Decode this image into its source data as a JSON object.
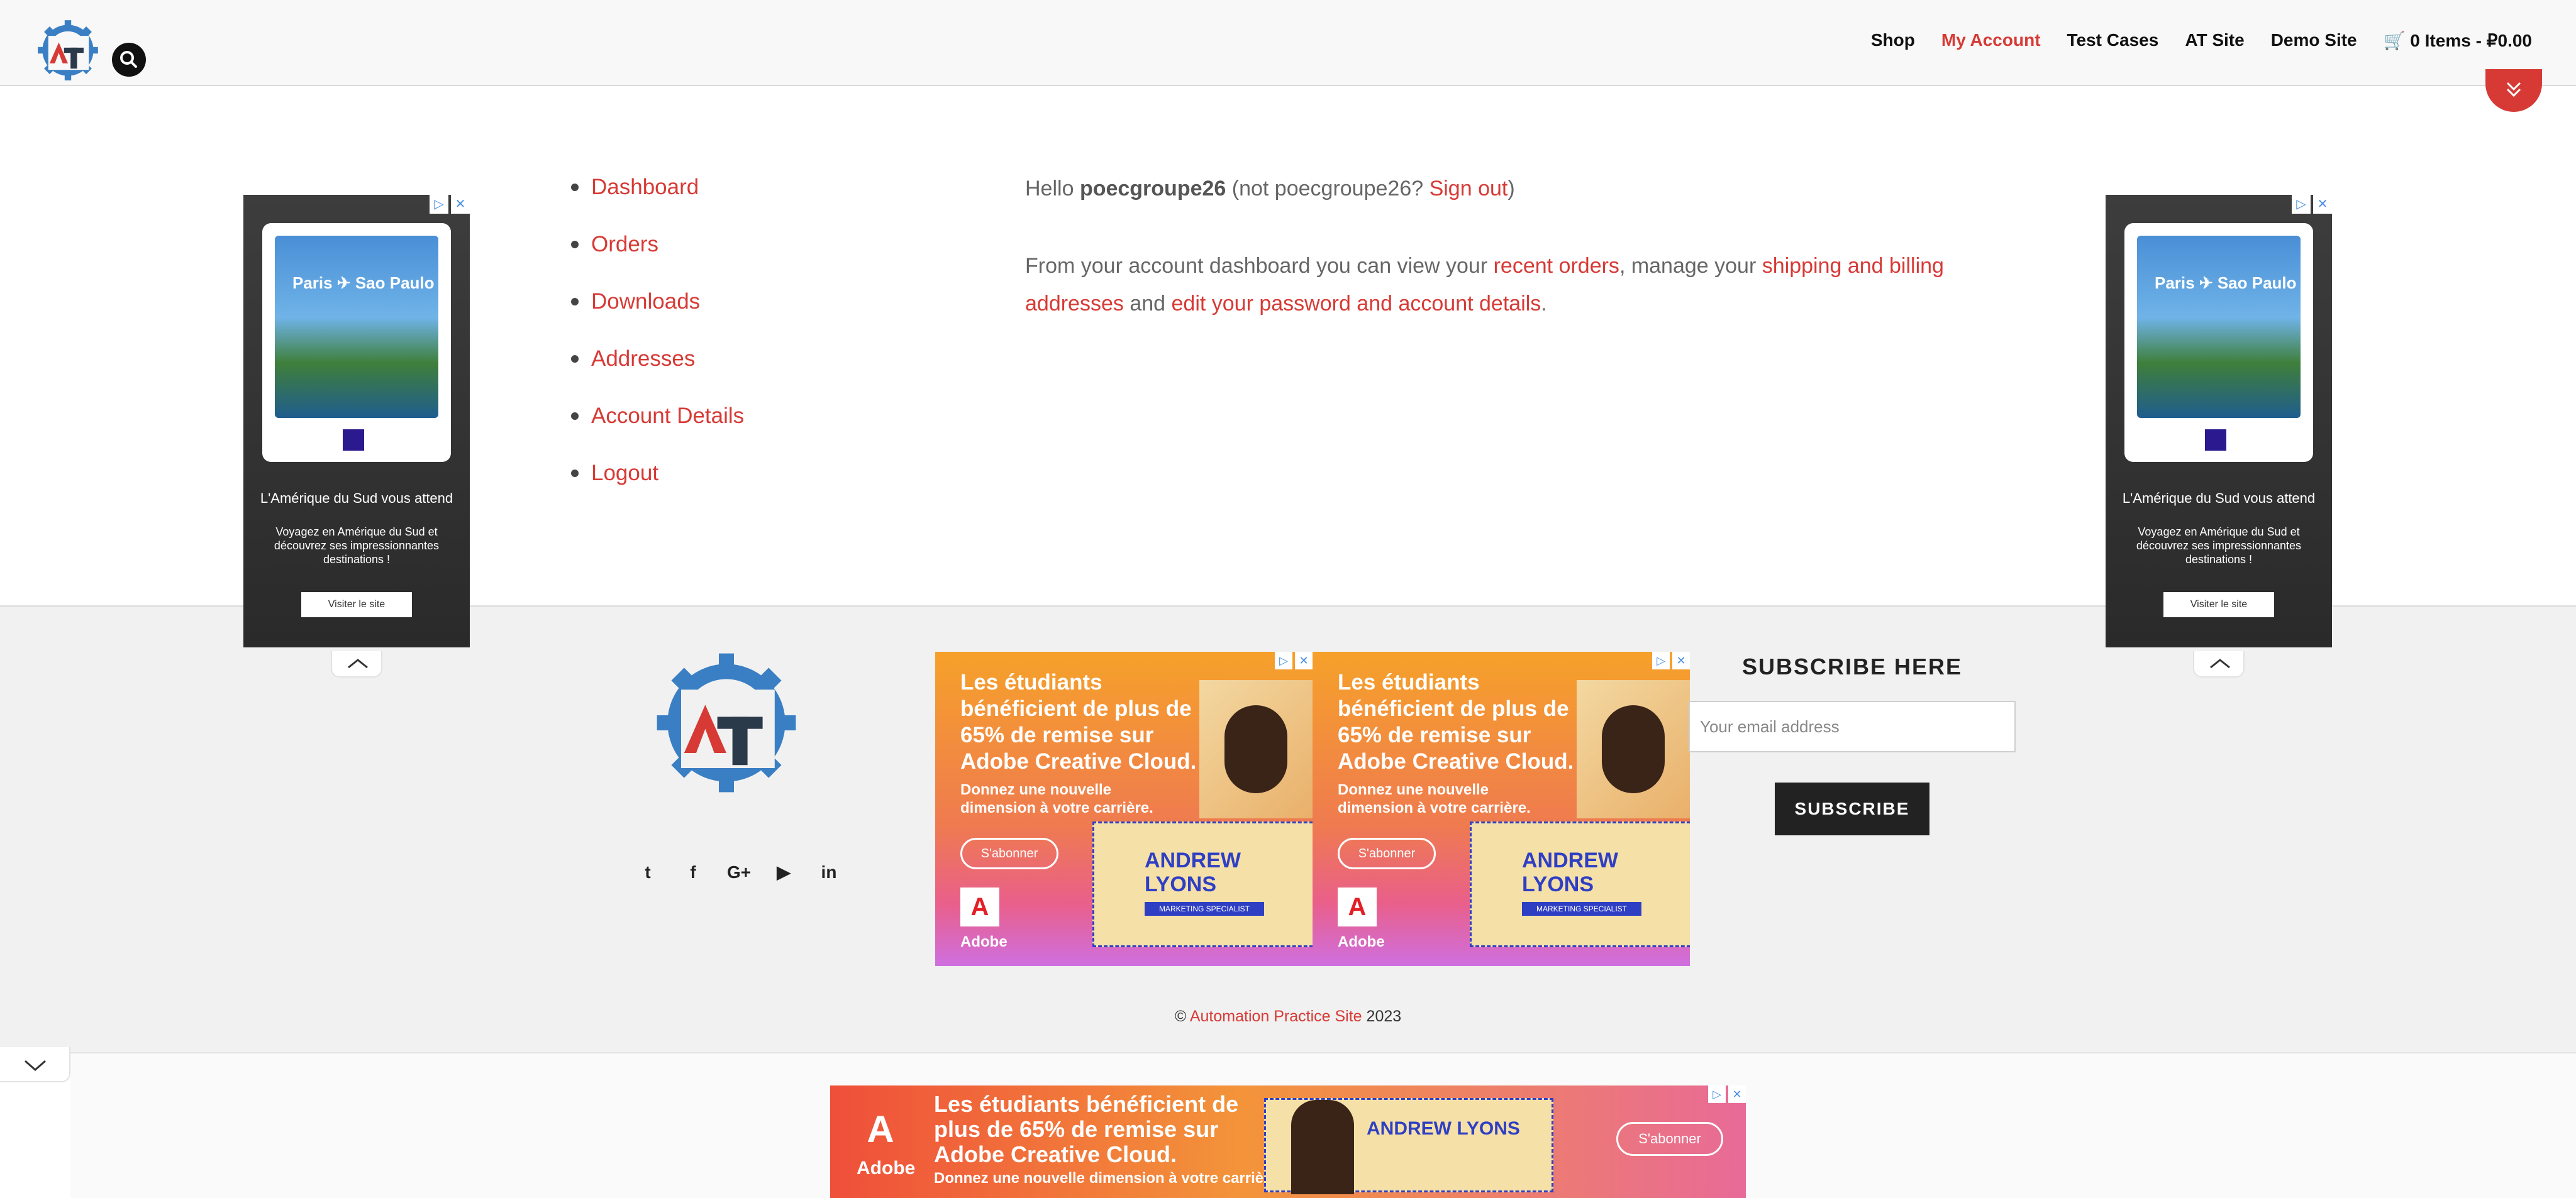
{
  "header": {
    "nav": [
      "Shop",
      "My Account",
      "Test Cases",
      "AT Site",
      "Demo Site"
    ],
    "active_nav": "My Account",
    "cart": "0 Items - ₽0.00",
    "icons": {
      "search": "search-icon",
      "cart": "cart-icon",
      "logo": "at-logo"
    }
  },
  "account": {
    "nav": [
      "Dashboard",
      "Orders",
      "Downloads",
      "Addresses",
      "Account Details",
      "Logout"
    ],
    "greeting": {
      "hello": "Hello ",
      "username": "poecgroupe26",
      "not_prefix": " (not poecgroupe26? ",
      "sign_out": "Sign out",
      "suffix": ")"
    },
    "intro": {
      "part1": "From your account dashboard you can view your ",
      "link1": "recent orders",
      "part2": ", manage your ",
      "link2": "shipping and billing addresses",
      "part3": " and ",
      "link3": "edit your password and account details",
      "part4": "."
    }
  },
  "side_ad": {
    "cities": "Paris ✈ Sao Paulo",
    "headline": "L'Amérique du Sud vous attend",
    "description": "Voyagez en Amérique du Sud et découvrez ses impressionnantes destinations !",
    "cta": "Visiter le site",
    "marks": [
      "▷",
      "✕"
    ]
  },
  "promo": {
    "title": "Les étudiants bénéficient de plus de 65% de remise sur Adobe Creative Cloud.",
    "subtitle": "Donnez une nouvelle dimension à votre carrière.",
    "button": "S'abonner",
    "brand": "Adobe",
    "brand_mark": "A",
    "card_name": "ANDREW LYONS",
    "card_role": "MARKETING SPECIALIST",
    "marks": [
      "▷",
      "✕"
    ]
  },
  "footer": {
    "social": [
      "twitter-icon",
      "facebook-icon",
      "google-plus-icon",
      "youtube-icon",
      "linkedin-icon"
    ],
    "social_glyphs": [
      "t",
      "f",
      "G+",
      "▶",
      "in"
    ],
    "subscribe_title": "SUBSCRIBE HERE",
    "email_placeholder": "Your email address",
    "subscribe_button": "SUBSCRIBE",
    "copyright_prefix": "© ",
    "copyright_link": "Automation Practice Site",
    "copyright_year": " 2023"
  },
  "banner": {
    "title": "Les étudiants bénéficient de plus de 65% de remise sur Adobe Creative Cloud.",
    "subtitle": "Donnez une nouvelle dimension à votre carrière.",
    "button": "S'abonner",
    "brand": "Adobe",
    "brand_mark": "A",
    "card_name": "ANDREW LYONS"
  },
  "colors": {
    "accent": "#d73a35",
    "dark": "#222222",
    "logo_blue": "#3a7fc4"
  }
}
